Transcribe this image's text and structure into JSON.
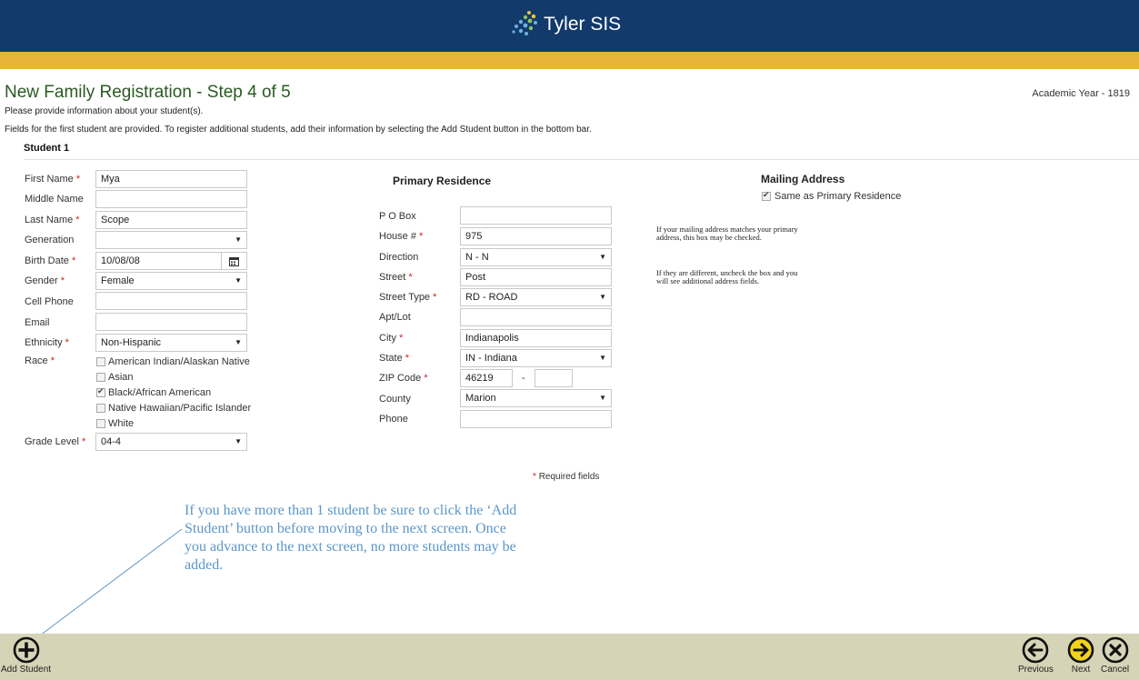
{
  "app": {
    "brand": "Tyler SIS"
  },
  "page": {
    "title": "New Family Registration - Step 4 of 5",
    "academic_year": "Academic Year - 1819",
    "intro1": "Please provide information about your student(s).",
    "intro2": "Fields for the first student are provided. To register additional students, add their information by selecting the Add Student button in the bottom bar.",
    "student_heading": "Student 1"
  },
  "student": {
    "first_name": {
      "label": "First Name",
      "value": "Mya"
    },
    "middle_name": {
      "label": "Middle Name",
      "value": ""
    },
    "last_name": {
      "label": "Last Name",
      "value": "Scope"
    },
    "generation": {
      "label": "Generation",
      "value": ""
    },
    "birth_date": {
      "label": "Birth Date",
      "value": "10/08/08"
    },
    "gender": {
      "label": "Gender",
      "value": "Female"
    },
    "cell_phone": {
      "label": "Cell Phone",
      "value": ""
    },
    "email": {
      "label": "Email",
      "value": ""
    },
    "ethnicity": {
      "label": "Ethnicity",
      "value": "Non-Hispanic"
    },
    "race": {
      "label": "Race",
      "options": [
        {
          "label": "American Indian/Alaskan Native",
          "checked": false
        },
        {
          "label": "Asian",
          "checked": false
        },
        {
          "label": "Black/African American",
          "checked": true
        },
        {
          "label": "Native Hawaiian/Pacific Islander",
          "checked": false
        },
        {
          "label": "White",
          "checked": false
        }
      ]
    },
    "grade_level": {
      "label": "Grade Level",
      "value": "04-4"
    }
  },
  "primary_residence": {
    "heading": "Primary Residence",
    "po_box": {
      "label": "P O Box",
      "value": ""
    },
    "house": {
      "label": "House #",
      "value": "975"
    },
    "direction": {
      "label": "Direction",
      "value": "N - N"
    },
    "street": {
      "label": "Street",
      "value": "Post"
    },
    "street_type": {
      "label": "Street Type",
      "value": "RD - ROAD"
    },
    "apt_lot": {
      "label": "Apt/Lot",
      "value": ""
    },
    "city": {
      "label": "City",
      "value": "Indianapolis"
    },
    "state": {
      "label": "State",
      "value": "IN - Indiana"
    },
    "zip": {
      "label": "ZIP Code",
      "value": "46219",
      "separator": "-",
      "ext": ""
    },
    "county": {
      "label": "County",
      "value": "Marion"
    },
    "phone": {
      "label": "Phone",
      "value": ""
    }
  },
  "mailing": {
    "heading": "Mailing Address",
    "same_label": "Same as Primary Residence",
    "same_checked": true,
    "note1": "If your mailing address matches your primary address, this box may be checked.",
    "note2": "If they are different, uncheck the box and you will see additional address fields."
  },
  "required_mark": "*",
  "required_note": "Required fields",
  "callout": "If you have more than 1 student be sure to click the ‘Add Student’ button before moving to the next screen.  Once you advance to the next screen, no more students may be added.",
  "bottom_bar": {
    "add_student": "Add Student",
    "previous": "Previous",
    "next": "Next",
    "cancel": "Cancel"
  },
  "colors": {
    "header_blue": "#123a6b",
    "gold": "#e6b53a",
    "title_green": "#2a5a22",
    "required_red": "#d21f1f",
    "callout_blue": "#5b96c9",
    "bottom_bar": "#d6d4b6",
    "next_yellow": "#f2d31b"
  }
}
